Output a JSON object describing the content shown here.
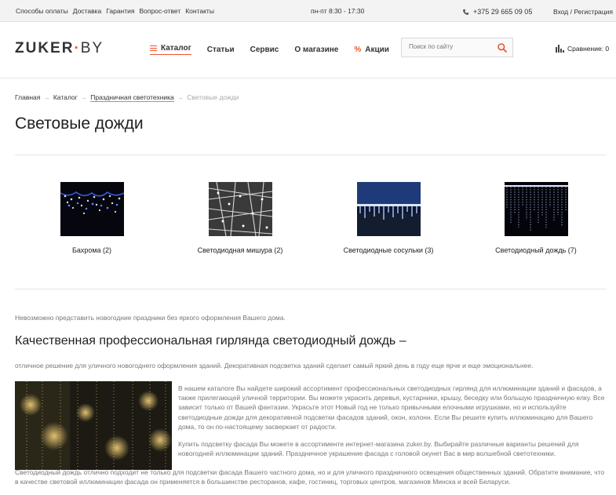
{
  "topbar": {
    "links": [
      "Способы оплаты",
      "Доставка",
      "Гарантия",
      "Вопрос-ответ",
      "Контакты"
    ],
    "hours": "пн-пт 8:30 - 17:30",
    "phone": "+375 29 665 09 05",
    "login": "Вход / Регистрация"
  },
  "header": {
    "logo_main": "ZUKER",
    "logo_dot": "·",
    "logo_tld": "BY",
    "nav": {
      "catalog": "Каталог",
      "articles": "Статьи",
      "service": "Сервис",
      "about": "О магазине",
      "sales": "Акции"
    },
    "search_placeholder": "Поиск по сайту",
    "compare": "Сравнение: 0"
  },
  "breadcrumb": {
    "home": "Главная",
    "sep": "→",
    "catalog": "Каталог",
    "section": "Праздничная светотехника",
    "current": "Световые дожди"
  },
  "page_title": "Световые дожди",
  "categories": [
    {
      "label": "Бахрома (2)"
    },
    {
      "label": "Светодиодная мишура (2)"
    },
    {
      "label": "Светодиодные сосульки (3)"
    },
    {
      "label": "Светодиодный дождь (7)"
    }
  ],
  "content": {
    "intro": "Невозможно представить новогодние праздники без яркого оформления Вашего дома.",
    "heading": "Качественная профессиональная гирлянда светодиодный дождь –",
    "line": "отличное решение для уличного новогоднего оформления зданий. Декоративная подсветка зданий сделает самый яркий день в году еще ярче и еще эмоциональнее.",
    "p1": "В нашем каталоге Вы найдете широкий ассортимент профессиональных светодиодных гирлянд для иллюминации зданий и фасадов, а также прилегающей уличной территории. Вы можете украсить деревья, кустарники, крышу, беседку или большую праздничную елку. Все зависит только от Вашей фантазии. Украсьте этот Новый год не только привычными елочными игрушками, но и используйте светодиодные дожди для декоративной подсветки фасадов зданий, окон, колонн. Если Вы решите купить иллюминацию для Вашего дома, то он по-настоящему засверкает от радости.",
    "p2": "Купить подсветку фасада Вы можете в ассортименте интернет-магазина zuker.by. Выбирайте различные варианты решений для новогодней иллюминации зданий. Праздничное украшение фасада с головой окунет Вас в мир волшебной светотехники.",
    "p3": "Светодиодный дождь отлично подходит не только для подсветки фасада Вашего частного дома, но и для уличного праздничного освещения общественных зданий. Обратите внимание, что в качестве световой иллюминации фасада он применяется в большинстве ресторанов, кафе, гостиниц, торговых центров, магазинов Минска и всей Беларуси."
  },
  "colors": {
    "accent": "#e8572b",
    "muted_text": "#777777",
    "topbar_bg": "#f3f3f3"
  }
}
